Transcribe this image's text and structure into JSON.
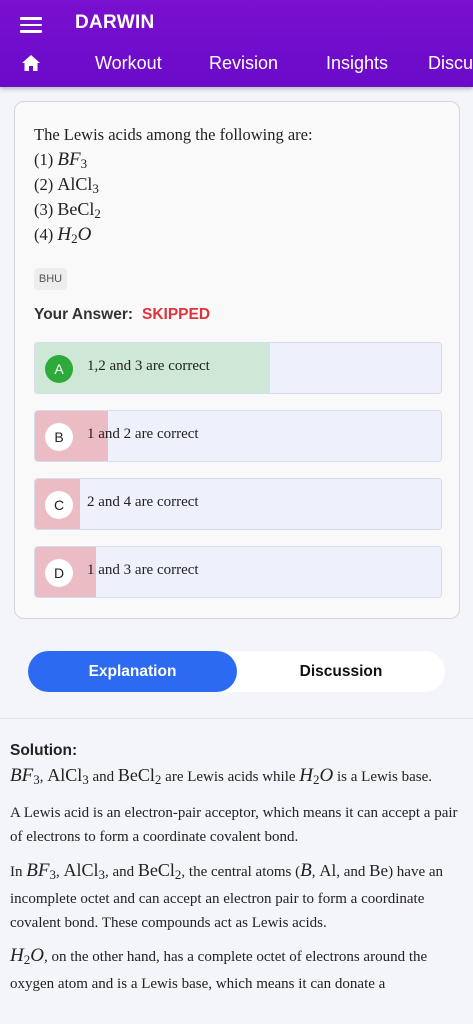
{
  "app": {
    "title": "DARWIN"
  },
  "nav": {
    "tabs": [
      "Workout",
      "Revision",
      "Insights",
      "Discu"
    ]
  },
  "question": {
    "intro": "The Lewis acids among the following are:",
    "items": [
      {
        "num": "(1)",
        "formula": "BF",
        "sub": "3"
      },
      {
        "num": "(2)",
        "formula": "AlCl",
        "sub": "3"
      },
      {
        "num": "(3)",
        "formula": "BeCl",
        "sub": "2"
      },
      {
        "num": "(4)",
        "formula": "H",
        "sub": "2",
        "tail": "O"
      }
    ],
    "tag": "BHU",
    "answer_label": "Your Answer:",
    "answer_value": "SKIPPED"
  },
  "options": [
    {
      "letter": "A",
      "text": "1,2 and 3 are correct",
      "share": 0.58,
      "correct": true
    },
    {
      "letter": "B",
      "text": "1 and 2 are correct",
      "share": 0.18,
      "correct": false
    },
    {
      "letter": "C",
      "text": "2 and 4 are correct",
      "share": 0.11,
      "correct": false
    },
    {
      "letter": "D",
      "text": "1 and 3 are correct",
      "share": 0.15,
      "correct": false
    }
  ],
  "colors": {
    "correct_fill": "#cfe7d6",
    "wrong_fill": "#ecbcc5",
    "accent": "#2c6bf1",
    "brand": "#7a0fcf"
  },
  "toggle": {
    "active": "Explanation",
    "inactive": "Discussion"
  },
  "solution": {
    "title": "Solution:",
    "p1": {
      "a": "BF",
      "a_sub": "3",
      "sep1": ", ",
      "b": "AlCl",
      "b_sub": "3",
      "and": " and ",
      "c": "BeCl",
      "c_sub": "2",
      "mid": " are Lewis acids while ",
      "d": "H",
      "d_sub": "2",
      "d_tail": "O",
      "end": " is a Lewis base."
    },
    "p2": "A Lewis acid is an electron-pair acceptor, which means it can accept a pair of electrons to form a coordinate covalent bond.",
    "p3": {
      "pre": "In ",
      "a": "BF",
      "a_sub": "3",
      "sep1": ", ",
      "b": "AlCl",
      "b_sub": "3",
      "sep2": ", and ",
      "c": "BeCl",
      "c_sub": "2",
      "mid": ", the central atoms (",
      "x": "B",
      "sep3": ", ",
      "y": "Al",
      "sep4": ", and ",
      "z": "Be",
      "end": ") have an incomplete octet and can accept an electron pair to form a coordinate covalent bond. These compounds act as Lewis acids."
    },
    "p4": {
      "a": "H",
      "a_sub": "2",
      "a_tail": "O",
      "end": ", on the other hand, has a complete octet of electrons around the oxygen atom and is a Lewis base, which means it can donate a"
    }
  }
}
